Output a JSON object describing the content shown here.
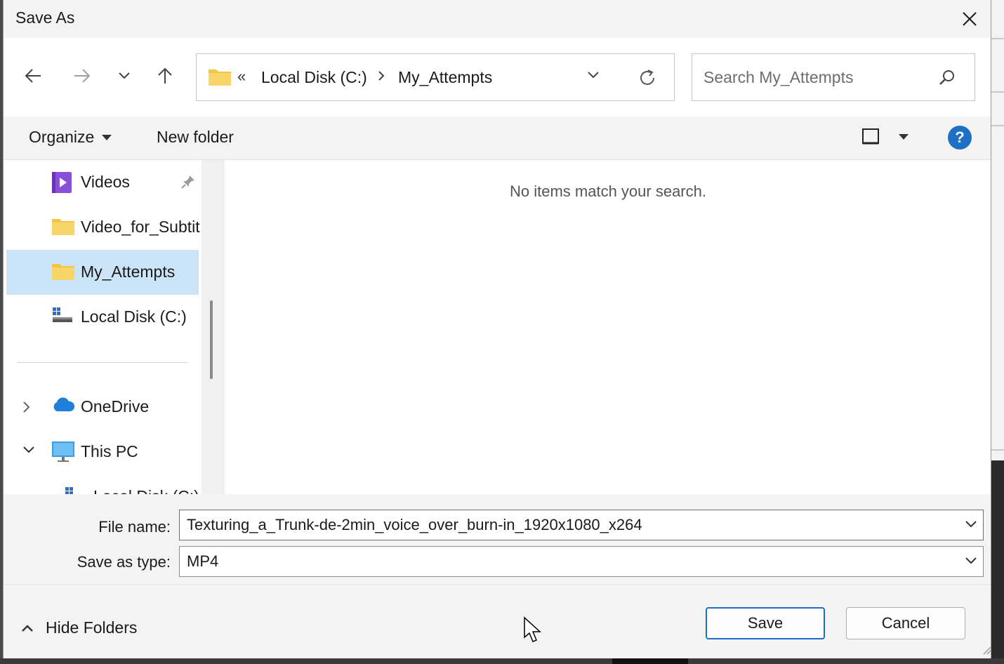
{
  "window": {
    "title": "Save As",
    "close_icon": "close-icon"
  },
  "nav": {
    "back_icon": "arrow-left-icon",
    "forward_icon": "arrow-right-icon",
    "recent_icon": "chevron-down-icon",
    "up_icon": "arrow-up-icon"
  },
  "address": {
    "overflow": "«",
    "segments": [
      "Local Disk (C:)",
      "My_Attempts"
    ]
  },
  "search": {
    "placeholder": "Search My_Attempts"
  },
  "toolbar": {
    "organize_label": "Organize",
    "new_folder_label": "New folder",
    "help_label": "?"
  },
  "sidebar": {
    "items": [
      {
        "label": "Videos",
        "icon": "videos-folder-icon",
        "pinned": true
      },
      {
        "label": "Video_for_Subtit",
        "icon": "folder-icon"
      },
      {
        "label": "My_Attempts",
        "icon": "folder-icon",
        "selected": true
      },
      {
        "label": "Local Disk (C:)",
        "icon": "drive-icon"
      },
      {
        "label": "OneDrive",
        "icon": "cloud-icon",
        "expander": "collapsed"
      },
      {
        "label": "This PC",
        "icon": "computer-icon",
        "expander": "expanded"
      },
      {
        "label": "Local Disk (C:)",
        "icon": "drive-icon",
        "partially_visible": true
      }
    ]
  },
  "content": {
    "empty_message": "No items match your search."
  },
  "fields": {
    "file_name_label": "File name:",
    "file_name_value": "Texturing_a_Trunk-de-2min_voice_over_burn-in_1920x1080_x264",
    "save_type_label": "Save as type:",
    "save_type_value": "MP4"
  },
  "footer": {
    "hide_folders_label": "Hide Folders",
    "save_label": "Save",
    "cancel_label": "Cancel"
  },
  "colors": {
    "accent": "#1f6fc5",
    "selection": "#cce4f7",
    "folder": "#f4c542"
  }
}
